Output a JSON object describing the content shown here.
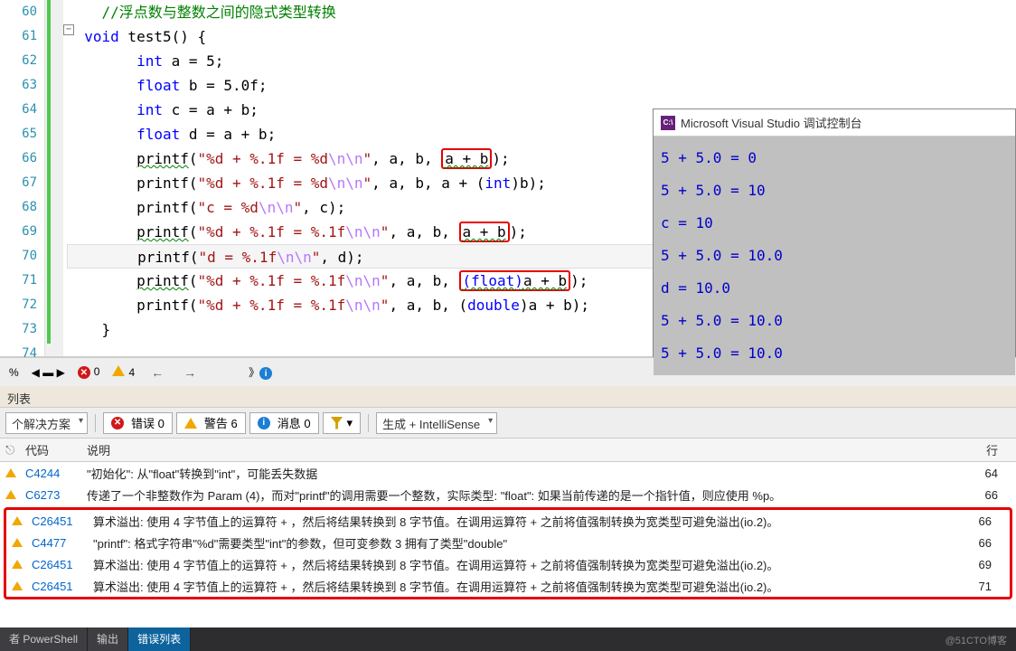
{
  "gutter": [
    "60",
    "61",
    "62",
    "63",
    "64",
    "65",
    "66",
    "67",
    "68",
    "69",
    "70",
    "71",
    "72",
    "73",
    "74"
  ],
  "code": {
    "l60": "//浮点数与整数之间的隐式类型转换",
    "l61_kw1": "void",
    "l61_fn": " test5",
    "l61_rest": "() {",
    "l62_kw": "int",
    "l62_rest": " a = 5;",
    "l63_kw": "float",
    "l63_rest": " b = 5.0f;",
    "l64_kw": "int",
    "l64_rest": " c = a + b;",
    "l65_kw": "float",
    "l65_rest": " d = a + b;",
    "l66_fn": "printf",
    "l66_str1": "\"%d + %.1f = %d",
    "l66_esc": "\\n\\n",
    "l66_str2": "\"",
    "l66_mid": ", a, b, ",
    "l66_box": "a + b",
    "l66_end": ");",
    "l67_fn": "printf",
    "l67_str1": "\"%d + %.1f = %d",
    "l67_esc": "\\n\\n",
    "l67_str2": "\"",
    "l67_mid": ", a, b, a + (",
    "l67_kw": "int",
    "l67_end": ")b);",
    "l68_fn": "printf",
    "l68_str1": "\"c = %d",
    "l68_esc": "\\n\\n",
    "l68_str2": "\"",
    "l68_end": ", c);",
    "l69_fn": "printf",
    "l69_str1": "\"%d + %.1f = %.1f",
    "l69_esc": "\\n\\n",
    "l69_str2": "\"",
    "l69_mid": ", a, b, ",
    "l69_box": "a + b",
    "l69_end": ");",
    "l70_fn": "printf",
    "l70_str1": "\"d = %.1f",
    "l70_esc": "\\n\\n",
    "l70_str2": "\"",
    "l70_end": ", d);",
    "l71_fn": "printf",
    "l71_str1": "\"%d + %.1f = %.1f",
    "l71_esc": "\\n\\n",
    "l71_str2": "\"",
    "l71_mid": ", a, b, ",
    "l71_box": "(float)a + b",
    "l71_end": ");",
    "l72_fn": "printf",
    "l72_str1": "\"%d + %.1f = %.1f",
    "l72_esc": "\\n\\n",
    "l72_str2": "\"",
    "l72_mid": ", a, b, (",
    "l72_kw": "double",
    "l72_end": ")a + b);",
    "l73": "}"
  },
  "console": {
    "title": "Microsoft Visual Studio 调试控制台",
    "lines": [
      "5 + 5.0 = 0",
      "5 + 5.0 = 10",
      "c = 10",
      "5 + 5.0 = 10.0",
      "d = 10.0",
      "5 + 5.0 = 10.0",
      "5 + 5.0 = 10.0"
    ]
  },
  "status": {
    "pct": "%",
    "errors": "0",
    "warnings": "4"
  },
  "panel": {
    "title": "列表"
  },
  "toolbar": {
    "scope": "个解决方案",
    "errors_label": "错误 0",
    "warnings_label": "警告 6",
    "messages_label": "消息 0",
    "source": "生成 + IntelliSense"
  },
  "errorlist": {
    "hdr_code": "代码",
    "hdr_desc": "说明",
    "hdr_line": "行",
    "rows": [
      {
        "code": "C4244",
        "desc": "\"初始化\": 从\"float\"转换到\"int\"，可能丢失数据",
        "line": "64"
      },
      {
        "code": "C6273",
        "desc": "传递了一个非整数作为 Param (4)，而对\"printf\"的调用需要一个整数，实际类型: \"float\": 如果当前传递的是一个指针值，则应使用 %p。",
        "line": "66"
      },
      {
        "code": "C26451",
        "desc": "算术溢出: 使用 4 字节值上的运算符 + ，然后将结果转换到 8 字节值。在调用运算符 + 之前将值强制转换为宽类型可避免溢出(io.2)。",
        "line": "66"
      },
      {
        "code": "C4477",
        "desc": "\"printf\": 格式字符串\"%d\"需要类型\"int\"的参数，但可变参数 3 拥有了类型\"double\"",
        "line": "66"
      },
      {
        "code": "C26451",
        "desc": "算术溢出: 使用 4 字节值上的运算符 + ，然后将结果转换到 8 字节值。在调用运算符 + 之前将值强制转换为宽类型可避免溢出(io.2)。",
        "line": "69"
      },
      {
        "code": "C26451",
        "desc": "算术溢出: 使用 4 字节值上的运算符 + ，然后将结果转换到 8 字节值。在调用运算符 + 之前将值强制转换为宽类型可避免溢出(io.2)。",
        "line": "71"
      }
    ]
  },
  "tabs": {
    "powershell": "者 PowerShell",
    "output": "输出",
    "errorlist": "错误列表"
  },
  "watermark": "@51CTO博客"
}
